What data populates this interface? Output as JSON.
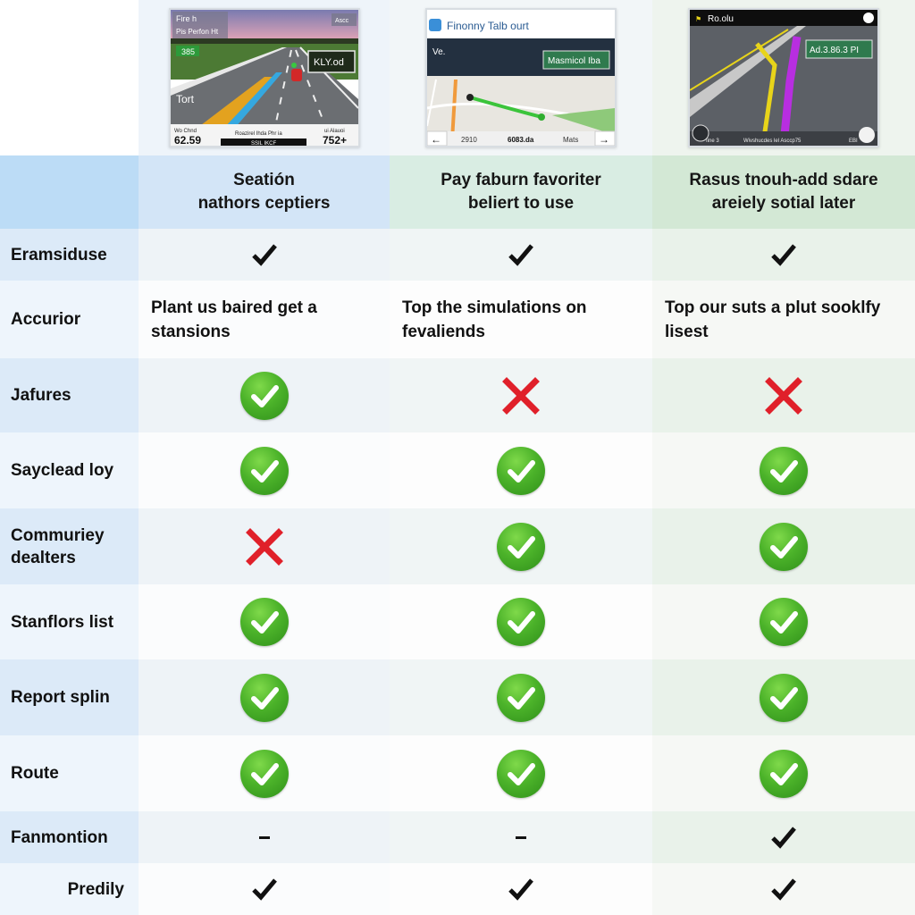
{
  "screenshots": [
    {
      "name": "highway-nav",
      "top_left_text": [
        "Fire h",
        "Pis Perfon Ht"
      ],
      "top_right_badge": "Ascc",
      "lane_badge": "385",
      "sign_text": "KLY.od",
      "side_text": "Tort",
      "bottom_left_label": "Wo Chnd",
      "bottom_left_value": "62.59",
      "bottom_center_label": "Roazirel Ihda Phr ia",
      "bottom_center_sub": "SSIL IKCF",
      "bottom_right_label": "ui Alauoi",
      "bottom_right_value": "752+"
    },
    {
      "name": "map-nav",
      "app_title": "Finonny Talb ourt",
      "left_overlay": "Ve.",
      "sign_text": "Masmicol Iba",
      "bottom_left": "2910",
      "bottom_center": "6083.da",
      "bottom_right": "Mats",
      "back_button": "←",
      "forward_button": "→"
    },
    {
      "name": "street-nav",
      "title": "Ro.olu",
      "sign_text": "Ad.3.86.3 PI",
      "bottom_left": "Iine 3",
      "bottom_center": "Wivshucdes lel Asccp75",
      "bottom_right": "EBI"
    }
  ],
  "columns": [
    {
      "title_line1": "Seatión",
      "title_line2": "nathors ceptiers"
    },
    {
      "title_line1": "Pay faburn favoriter",
      "title_line2": "beliert to use"
    },
    {
      "title_line1": "Rasus tnouh-add sdare",
      "title_line2": "areiely sotial later"
    }
  ],
  "rows": [
    {
      "label": "Eramsiduse",
      "values": [
        "check",
        "check",
        "check"
      ]
    },
    {
      "label": "Accurior",
      "values": [
        "text",
        "text",
        "text"
      ],
      "texts": [
        "Plant us baired get a stansions",
        "Top the simulations on fevaliends",
        "Top our suts a plut sooklfy lisest"
      ]
    },
    {
      "label": "Jafures",
      "values": [
        "green-check",
        "red-x",
        "red-x"
      ]
    },
    {
      "label": "Sayclead loy",
      "values": [
        "green-check",
        "green-check",
        "green-check"
      ]
    },
    {
      "label": "Commuriey dealters",
      "values": [
        "red-x",
        "green-check",
        "green-check"
      ]
    },
    {
      "label": "Stanflors list",
      "values": [
        "green-check",
        "green-check",
        "green-check"
      ]
    },
    {
      "label": "Report splin",
      "values": [
        "green-check",
        "green-check",
        "green-check"
      ]
    },
    {
      "label": "Route",
      "values": [
        "green-check",
        "green-check",
        "green-check"
      ]
    },
    {
      "label": "Fanmontion",
      "values": [
        "dash",
        "dash",
        "check"
      ]
    },
    {
      "label": "Predily",
      "values": [
        "check",
        "check",
        "check"
      ]
    }
  ],
  "colors": {
    "green": "#4cb32a",
    "red": "#e0202a",
    "header_blue": "#bcdcf6",
    "header_green": "#d3e8d5"
  }
}
